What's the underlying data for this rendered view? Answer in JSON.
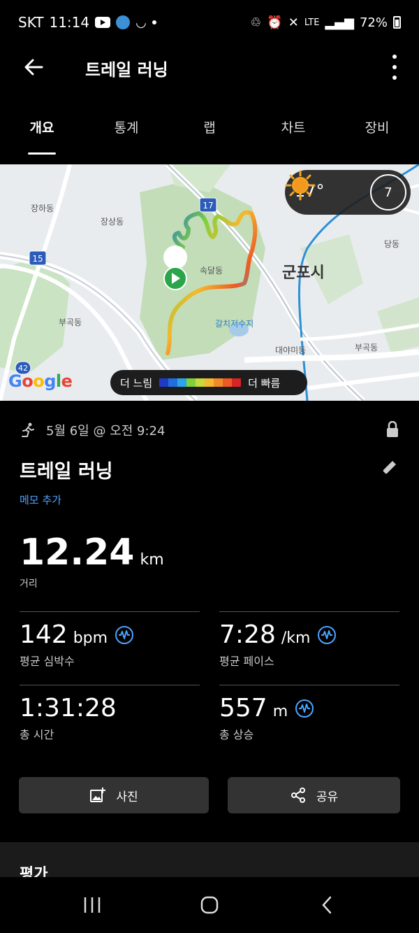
{
  "status": {
    "carrier": "SKT",
    "time": "11:14",
    "network": "LTE",
    "battery": "72%"
  },
  "header": {
    "title": "트레일 러닝"
  },
  "tabs": [
    "개요",
    "통계",
    "랩",
    "차트",
    "장비"
  ],
  "map": {
    "labels": {
      "janghadong": "장하동",
      "jangsangdong": "장상동",
      "sokdaldong": "속달동",
      "gunposi": "군포시",
      "bugokdong_left": "부곡동",
      "bugokdong_right": "부곡동",
      "reservoir": "갈치저수지",
      "daeyamidong": "대야미동",
      "dangdong": "당동",
      "road_15": "15",
      "road_17": "17",
      "road_42": "42"
    },
    "logo": "Google",
    "weather": {
      "temp": "17°",
      "uv": "7"
    },
    "legend": {
      "slow": "더 느림",
      "fast": "더 빠름",
      "colors": [
        "#1f3cc7",
        "#1f6fe0",
        "#2aa6e8",
        "#7fd13b",
        "#c8d93b",
        "#f5b82e",
        "#f28a2a",
        "#ee5a24",
        "#d82424"
      ]
    }
  },
  "activity": {
    "datetime": "5월 6일 @ 오전 9:24",
    "title": "트레일 러닝",
    "memo": "메모 추가",
    "distance": {
      "value": "12.24",
      "unit": "km",
      "label": "거리"
    }
  },
  "stats": {
    "heart_rate": {
      "value": "142",
      "unit": "bpm",
      "label": "평균 심박수"
    },
    "pace": {
      "value": "7:28",
      "unit": "/km",
      "label": "평균 페이스"
    },
    "duration": {
      "value": "1:31:28",
      "unit": "",
      "label": "총 시간"
    },
    "ascent": {
      "value": "557",
      "unit": "m",
      "label": "총 상승"
    }
  },
  "actions": {
    "photo": "사진",
    "share": "공유"
  },
  "next_section": "평가",
  "colors": {
    "accent": "#4ea3ff",
    "background": "#000000",
    "button": "#333333"
  }
}
